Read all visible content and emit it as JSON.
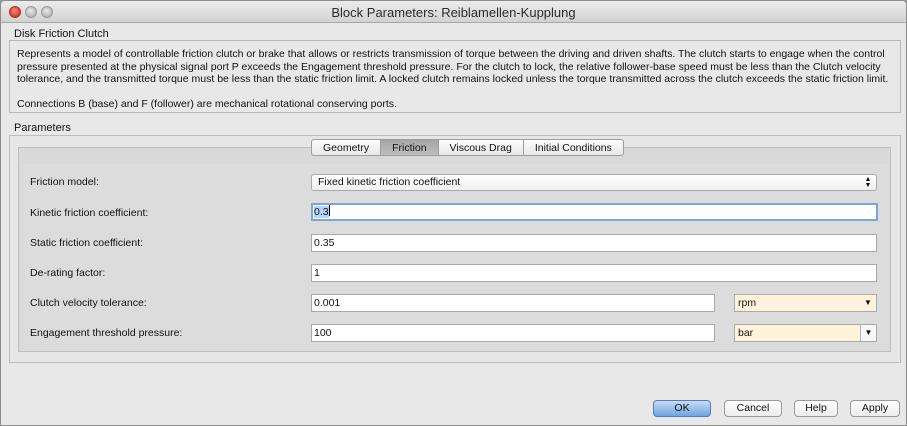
{
  "window": {
    "title": "Block Parameters: Reiblamellen-Kupplung"
  },
  "block": {
    "name": "Disk Friction Clutch",
    "description": "Represents a model of controllable friction clutch or brake that allows or restricts transmission of torque between the driving and driven shafts. The clutch starts to engage when the control pressure presented at the physical signal port P exceeds the Engagement threshold pressure. For the clutch to lock, the relative follower-base speed must be less than the Clutch velocity tolerance, and the transmitted torque must be less than the static friction limit. A locked clutch remains locked unless the torque transmitted across the clutch exceeds the static friction limit.",
    "connections": "Connections B (base) and F (follower) are mechanical rotational conserving ports."
  },
  "parameters": {
    "label": "Parameters",
    "tabs": [
      {
        "label": "Geometry",
        "active": false
      },
      {
        "label": "Friction",
        "active": true
      },
      {
        "label": "Viscous Drag",
        "active": false
      },
      {
        "label": "Initial Conditions",
        "active": false
      }
    ],
    "friction_model": {
      "label": "Friction model:",
      "value": "Fixed kinetic friction coefficient"
    },
    "kinetic": {
      "label": "Kinetic friction coefficient:",
      "value": "0.3"
    },
    "static": {
      "label": "Static friction coefficient:",
      "value": "0.35"
    },
    "derating": {
      "label": "De-rating factor:",
      "value": "1"
    },
    "velocity_tol": {
      "label": "Clutch velocity tolerance:",
      "value": "0.001",
      "unit": "rpm"
    },
    "engagement": {
      "label": "Engagement threshold pressure:",
      "value": "100",
      "unit": "bar"
    }
  },
  "buttons": {
    "ok": "OK",
    "cancel": "Cancel",
    "help": "Help",
    "apply": "Apply"
  },
  "colors": {
    "accent": "#7aa7d8",
    "unit_bg": "#fff3dc",
    "close": "#d9372b"
  },
  "icons": [
    "close-icon",
    "minimize-icon",
    "zoom-icon",
    "updown-arrows-icon",
    "dropdown-arrow-icon"
  ]
}
